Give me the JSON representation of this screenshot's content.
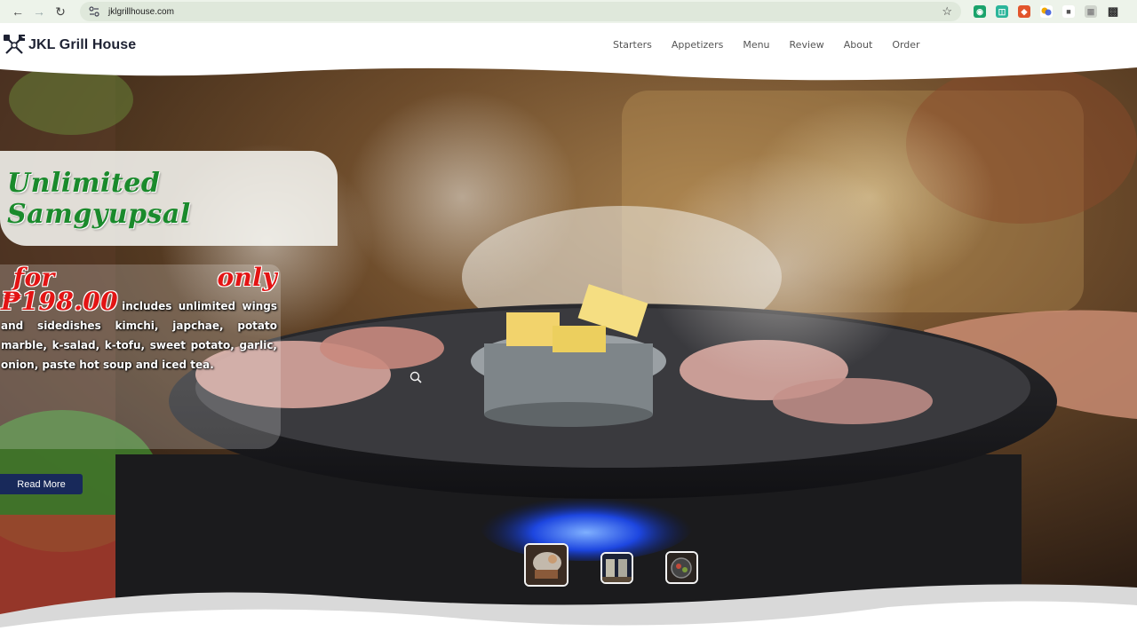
{
  "browser": {
    "url": "jklgrillhouse.com",
    "icons": [
      "back-arrow-icon",
      "forward-arrow-icon",
      "reload-icon",
      "site-settings-icon",
      "bookmark-star-icon",
      "extensions-puzzle-icon"
    ]
  },
  "site": {
    "brand": "JKL Grill House",
    "nav": [
      "Starters",
      "Appetizers",
      "Menu",
      "Review",
      "About",
      "Order"
    ]
  },
  "hero": {
    "title": "Unlimited Samgyupsal",
    "price": "for only ₱198.00",
    "description": "includes unlimited wings and sidedishes kimchi, japchae, potato marble, k-salad, k-tofu, sweet potato, garlic, onion, paste hot soup and iced tea.",
    "cta": "Read More",
    "thumbnails": [
      "thumbnail-1",
      "thumbnail-2",
      "thumbnail-3"
    ]
  },
  "colors": {
    "title_green": "#1a8a2c",
    "price_red": "#e31414",
    "button_navy": "#18295a",
    "brand_dark": "#1e2233"
  }
}
